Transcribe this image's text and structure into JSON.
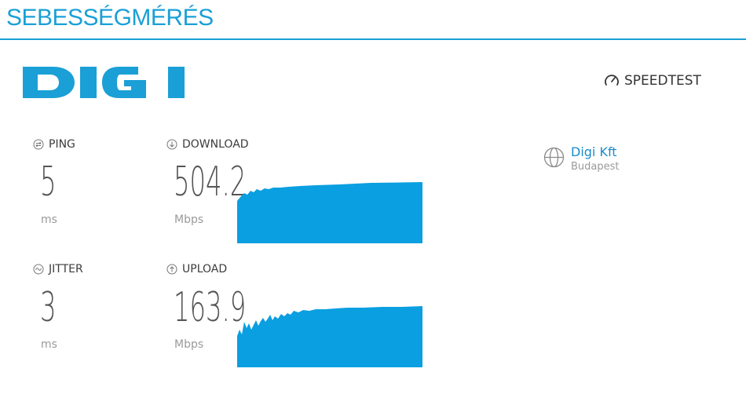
{
  "page": {
    "title": "SEBESSÉGMÉRÉS"
  },
  "brand": {
    "logo_text": "DIGI",
    "logo_color": "#1aa0d6"
  },
  "speedtest": {
    "label": "SPEEDTEST",
    "icon": "gauge-icon"
  },
  "metrics": {
    "ping": {
      "label": "PING",
      "value": "5",
      "unit": "ms",
      "icon": "ping-icon"
    },
    "jitter": {
      "label": "JITTER",
      "value": "3",
      "unit": "ms",
      "icon": "jitter-icon"
    },
    "download": {
      "label": "DOWNLOAD",
      "value": "504.2",
      "unit": "Mbps",
      "icon": "download-arrow-icon"
    },
    "upload": {
      "label": "UPLOAD",
      "value": "163.9",
      "unit": "Mbps",
      "icon": "upload-arrow-icon"
    }
  },
  "server": {
    "name": "Digi Kft",
    "location": "Budapest",
    "icon": "globe-icon"
  },
  "colors": {
    "accent": "#1aa0d6",
    "graph_fill": "#0a9fe0"
  }
}
